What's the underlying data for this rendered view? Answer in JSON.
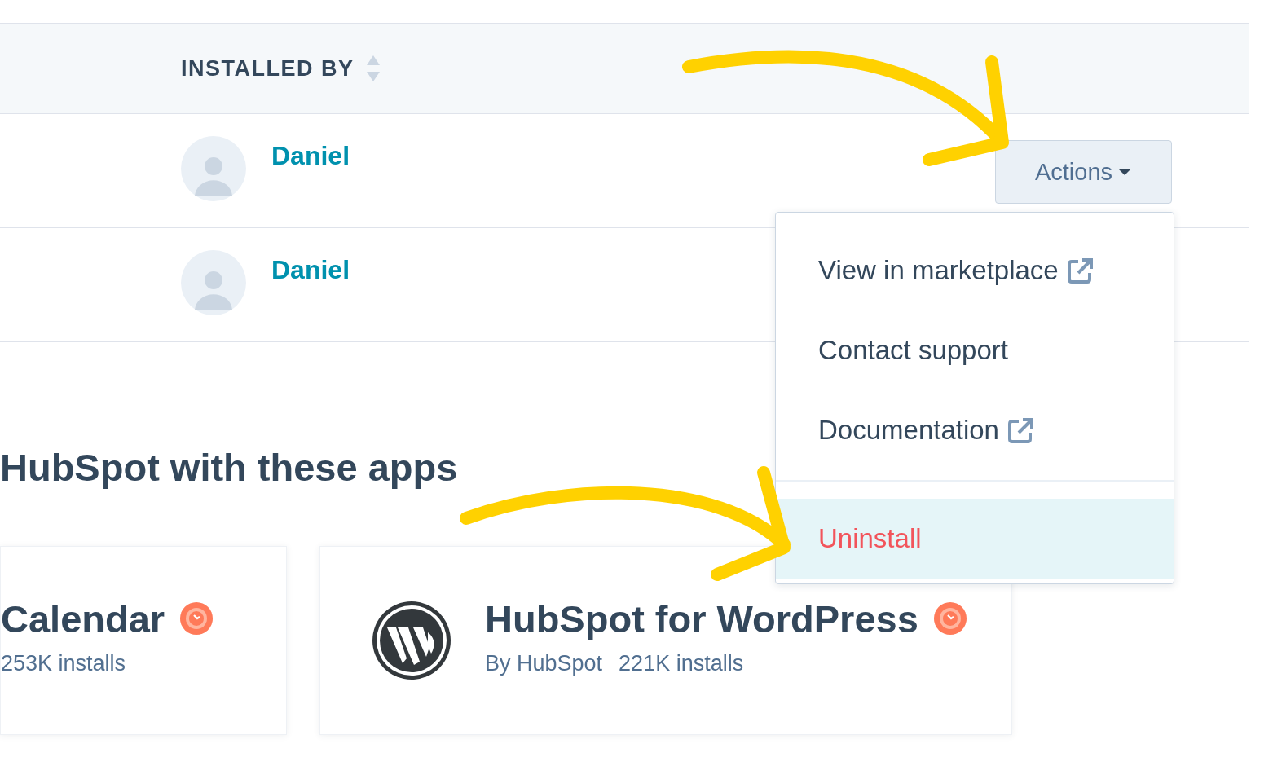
{
  "table": {
    "columns": [
      {
        "label": "INSTALLED BY"
      }
    ],
    "rows": [
      {
        "installer": "Daniel",
        "actions_button": "Actions"
      },
      {
        "installer": "Daniel"
      }
    ]
  },
  "actions_menu": {
    "open": true,
    "items": [
      {
        "label": "View in marketplace",
        "external": true,
        "kind": "normal",
        "selected": false
      },
      {
        "label": "Contact support",
        "external": false,
        "kind": "normal",
        "selected": false
      },
      {
        "label": "Documentation",
        "external": true,
        "kind": "normal",
        "selected": false
      },
      {
        "label": "Uninstall",
        "external": false,
        "kind": "danger",
        "selected": true
      }
    ]
  },
  "apps_section": {
    "heading": "HubSpot with these apps",
    "apps": [
      {
        "name": "Calendar",
        "certified": true,
        "kind": "plain",
        "installs": "253K installs"
      },
      {
        "name": "HubSpot for WordPress",
        "certified": true,
        "kind": "with-logo",
        "publisher": "By HubSpot",
        "installs": "221K installs"
      }
    ]
  },
  "annotations": [
    {
      "kind": "arrow"
    },
    {
      "kind": "arrow"
    }
  ]
}
